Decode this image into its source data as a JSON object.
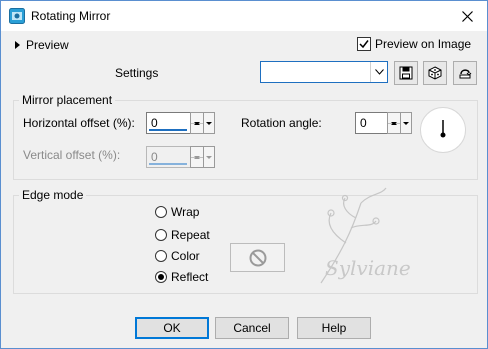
{
  "window": {
    "title": "Rotating Mirror",
    "close_icon": "close-icon",
    "app_icon": "mirror-app-icon"
  },
  "preview": {
    "toggle_label": "Preview",
    "checkbox_label": "Preview on Image",
    "checkbox_checked": true
  },
  "settings": {
    "label": "Settings",
    "value": "",
    "tools": [
      "save-preset-icon",
      "randomize-dice-icon",
      "reset-icon"
    ]
  },
  "mirror_placement": {
    "title": "Mirror placement",
    "horizontal_label": "Horizontal offset (%):",
    "horizontal_value": "0",
    "vertical_label": "Vertical offset (%):",
    "vertical_value": "0",
    "rotation_label": "Rotation angle:",
    "rotation_value": "0"
  },
  "edge_mode": {
    "title": "Edge mode",
    "options": [
      {
        "label": "Wrap",
        "selected": false
      },
      {
        "label": "Repeat",
        "selected": false
      },
      {
        "label": "Color",
        "selected": false
      },
      {
        "label": "Reflect",
        "selected": true
      }
    ]
  },
  "watermark_text": "Sylviane",
  "buttons": {
    "ok": "OK",
    "cancel": "Cancel",
    "help": "Help"
  },
  "colors": {
    "accent": "#0078d7",
    "window_bg": "#f0f0f0"
  }
}
